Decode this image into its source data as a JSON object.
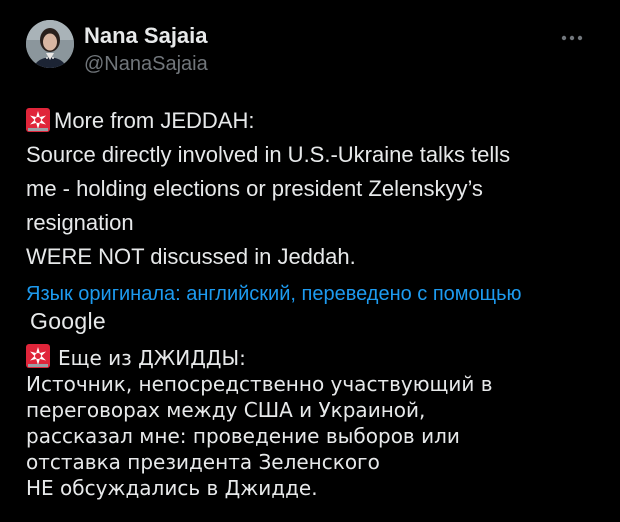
{
  "author": {
    "display_name": "Nana Sajaia",
    "handle": "@NanaSajaia",
    "avatar_icon": "profile-photo"
  },
  "more_menu_icon": "ellipsis-icon",
  "post": {
    "lines": [
      "More from JEDDAH:",
      "Source directly involved in U.S.-Ukraine talks tells",
      "me - holding elections or president Zelenskyy’s",
      "resignation",
      "WERE NOT discussed in Jeddah."
    ],
    "siren_icon": "rotating-light-emoji"
  },
  "translation": {
    "link_text": "Язык оригинала: английский, переведено с помощью",
    "provider": "Google",
    "lines": [
      "Еще из ДЖИДДЫ:",
      "Источник, непосредственно участвующий в",
      "переговорах между США и Украиной,",
      "рассказал мне: проведение выборов или",
      "отставка президента Зеленского",
      "НЕ обсуждались в Джидде."
    ]
  },
  "colors": {
    "background": "#000000",
    "text": "#e7e9ea",
    "secondary": "#71767b",
    "link": "#1d9bf0",
    "siren_red": "#e0253a"
  }
}
